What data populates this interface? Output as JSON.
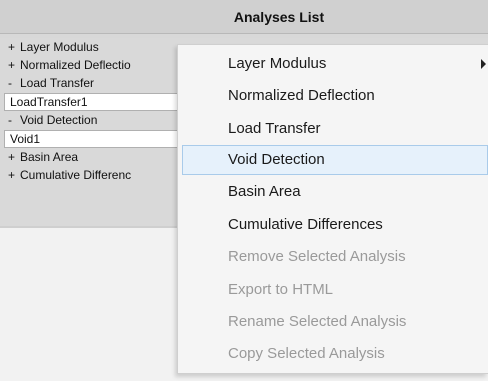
{
  "panel": {
    "title": "Analyses List"
  },
  "tree": {
    "rows": [
      {
        "sign": "+",
        "label": "Layer Modulus"
      },
      {
        "sign": "+",
        "label": "Normalized Deflectio"
      },
      {
        "sign": "-",
        "label": "Load Transfer"
      },
      {
        "child": "LoadTransfer1"
      },
      {
        "sign": "-",
        "label": "Void Detection"
      },
      {
        "child": "Void1"
      },
      {
        "sign": "+",
        "label": "Basin Area"
      },
      {
        "sign": "+",
        "label": "Cumulative Differenc"
      }
    ]
  },
  "menu": {
    "items": [
      {
        "label": "Layer Modulus",
        "enabled": true,
        "has_submenu": true
      },
      {
        "label": "Normalized Deflection",
        "enabled": true
      },
      {
        "label": "Load Transfer",
        "enabled": true
      },
      {
        "label": "Void Detection",
        "enabled": true,
        "highlighted": true
      },
      {
        "label": "Basin Area",
        "enabled": true
      },
      {
        "label": "Cumulative Differences",
        "enabled": true
      },
      {
        "label": "Remove Selected Analysis",
        "enabled": false
      },
      {
        "label": "Export to HTML",
        "enabled": false
      },
      {
        "label": "Rename Selected Analysis",
        "enabled": false
      },
      {
        "label": "Copy Selected Analysis",
        "enabled": false
      }
    ]
  },
  "colors": {
    "highlight_bg": "#e6f1fb",
    "highlight_border": "#a9cbea",
    "disabled_text": "#9a9a9a"
  }
}
